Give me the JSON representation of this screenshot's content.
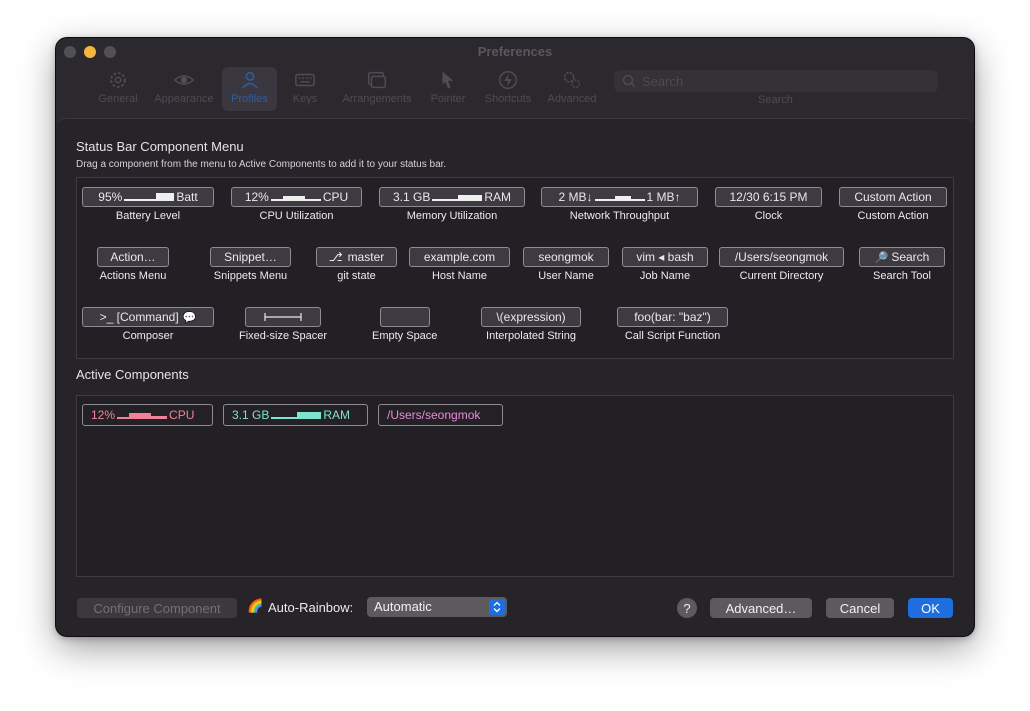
{
  "window": {
    "title": "Preferences",
    "toolbar": [
      {
        "label": "General",
        "icon": "gear-icon"
      },
      {
        "label": "Appearance",
        "icon": "eye-icon"
      },
      {
        "label": "Profiles",
        "icon": "person-icon"
      },
      {
        "label": "Keys",
        "icon": "keyboard-icon"
      },
      {
        "label": "Arrangements",
        "icon": "windows-icon"
      },
      {
        "label": "Pointer",
        "icon": "pointer-icon"
      },
      {
        "label": "Shortcuts",
        "icon": "bolt-icon"
      },
      {
        "label": "Advanced",
        "icon": "gears-icon"
      }
    ],
    "search_placeholder": "Search",
    "search_caption": "Search"
  },
  "menu": {
    "title": "Status Bar Component Menu",
    "subtitle": "Drag a component from the menu to Active Components to add it to your status bar.",
    "row1": [
      {
        "left": "95%",
        "right": "Batt",
        "label": "Battery Level"
      },
      {
        "left": "12%",
        "right": "CPU",
        "label": "CPU Utilization"
      },
      {
        "left": "3.1 GB",
        "right": "RAM",
        "label": "Memory Utilization"
      },
      {
        "left": "2 MB↓",
        "right": "1 MB↑",
        "label": "Network Throughput"
      },
      {
        "text": "12/30 6:15 PM",
        "label": "Clock"
      },
      {
        "text": "Custom Action",
        "label": "Custom Action"
      }
    ],
    "row2": [
      {
        "text": "Action…",
        "label": "Actions Menu"
      },
      {
        "text": "Snippet…",
        "label": "Snippets Menu"
      },
      {
        "icon": "⎇",
        "text": "master",
        "label": "git state"
      },
      {
        "text": "example.com",
        "label": "Host Name"
      },
      {
        "text": "seongmok",
        "label": "User Name"
      },
      {
        "text": "vim ◂ bash",
        "label": "Job Name"
      },
      {
        "text": "/Users/seongmok",
        "label": "Current Directory"
      },
      {
        "icon": "🔎",
        "text": "Search",
        "label": "Search Tool"
      }
    ],
    "row3": [
      {
        "text": ">_ [Command]",
        "icon": "💬",
        "label": "Composer"
      },
      {
        "label": "Fixed-size Spacer"
      },
      {
        "text": "",
        "label": "Empty Space"
      },
      {
        "text": "\\(expression)",
        "label": "Interpolated String"
      },
      {
        "text": "foo(bar: \"baz\")",
        "label": "Call Script Function"
      }
    ]
  },
  "active": {
    "title": "Active Components",
    "items": [
      {
        "left": "12%",
        "right": "CPU",
        "color": "#f0829a"
      },
      {
        "left": "3.1 GB",
        "right": "RAM",
        "color": "#7fe3d1"
      },
      {
        "text": "/Users/seongmok",
        "color": "#e98ad9"
      }
    ]
  },
  "footer": {
    "configure": "Configure Component",
    "rainbow_icon": "🌈",
    "rainbow_label": "Auto-Rainbow:",
    "rainbow_value": "Automatic",
    "help": "?",
    "advanced": "Advanced…",
    "cancel": "Cancel",
    "ok": "OK"
  },
  "colors": {
    "accent": "#1e6ee0",
    "window": "#232025",
    "traffic_minimize": "#f4b63d"
  }
}
